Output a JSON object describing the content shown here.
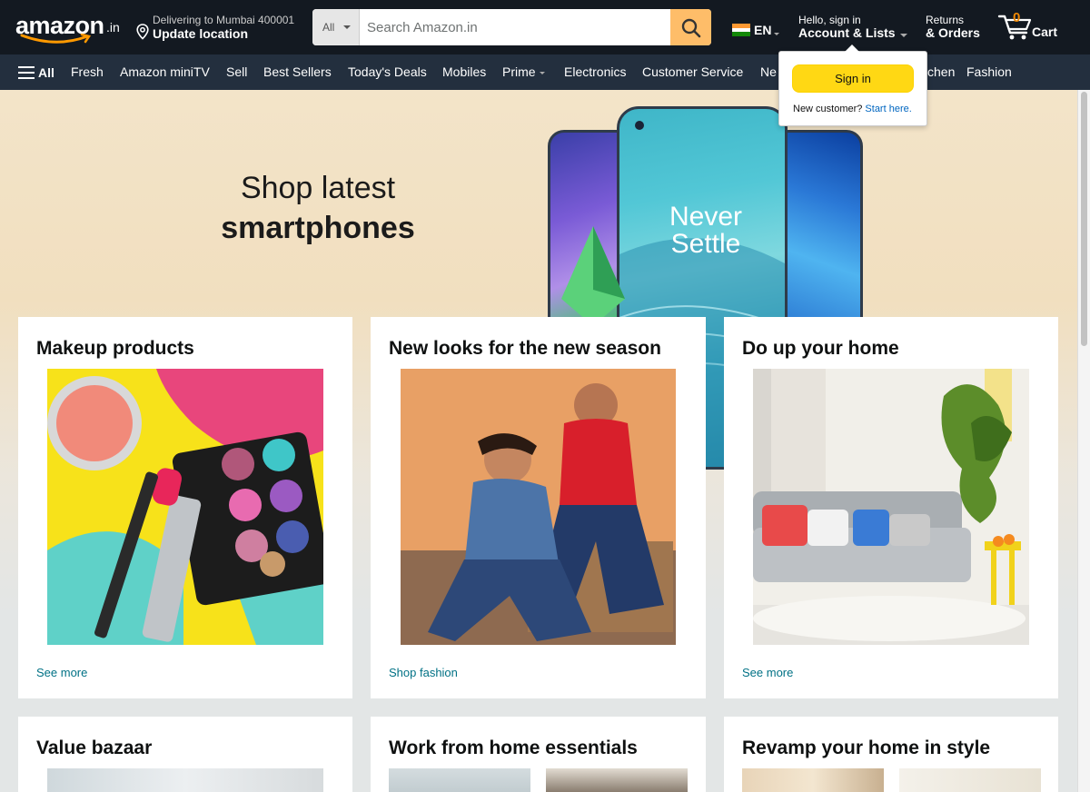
{
  "header": {
    "logo_text": "amazon",
    "logo_suffix": ".in",
    "deliver_line1": "Delivering to Mumbai 400001",
    "deliver_line2": "Update location",
    "search_category": "All",
    "search_placeholder": "Search Amazon.in",
    "language": "EN",
    "account_line1": "Hello, sign in",
    "account_line2": "Account & Lists",
    "returns_line1": "Returns",
    "returns_line2": "& Orders",
    "cart_count": "0",
    "cart_label": "Cart"
  },
  "nav": {
    "all_label": "All",
    "items": [
      "Fresh",
      "Amazon miniTV",
      "Sell",
      "Best Sellers",
      "Today's Deals",
      "Mobiles",
      "Prime",
      "Electronics",
      "Customer Service",
      "Ne",
      "chen",
      "Fashion"
    ]
  },
  "flyout": {
    "signin_label": "Sign in",
    "new_customer": "New customer?",
    "start_here": "Start here."
  },
  "hero": {
    "line1": "Shop latest",
    "line2": "smartphones",
    "phone_text1": "Never",
    "phone_text2": "Settle"
  },
  "cards": [
    {
      "title": "Makeup products",
      "link": "See more"
    },
    {
      "title": "New looks for the new season",
      "link": "Shop fashion"
    },
    {
      "title": "Do up your home",
      "link": "See more"
    },
    {
      "title": "Value bazaar"
    },
    {
      "title": "Work from home essentials"
    },
    {
      "title": "Revamp your home in style"
    }
  ],
  "colors": {
    "nav_dark": "#131921",
    "nav_sub": "#232f3e",
    "search_button": "#febd69",
    "signin_button": "#ffd814",
    "cart_count": "#f08804",
    "link": "#007185"
  }
}
